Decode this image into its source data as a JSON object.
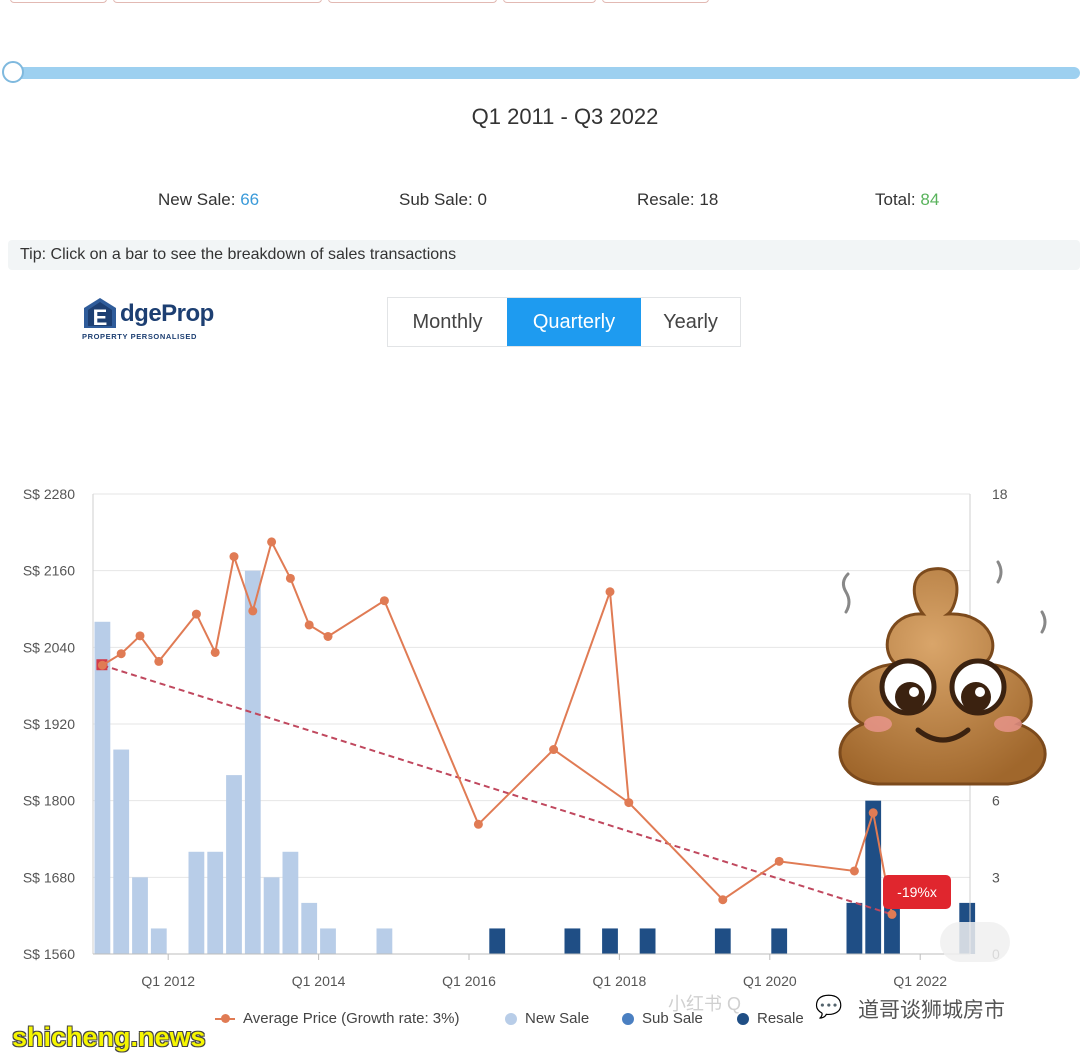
{
  "header": {
    "period_label": "Q1 2011 - Q3 2022",
    "stats": {
      "new_sale_label": "New Sale:",
      "new_sale_value": "66",
      "sub_sale_label": "Sub Sale:",
      "sub_sale_value": "0",
      "resale_label": "Resale:",
      "resale_value": "18",
      "total_label": "Total:",
      "total_value": "84"
    },
    "tip": "Tip: Click on a bar to see the breakdown of sales transactions"
  },
  "logo": {
    "word_e": "E",
    "word_rest": "dgeProp",
    "tagline": "PROPERTY PERSONALISED"
  },
  "toggle": {
    "options": [
      "Monthly",
      "Quarterly",
      "Yearly"
    ],
    "selected": "Quarterly"
  },
  "legend": {
    "average_price": "Average Price (Growth rate: 3%)",
    "new_sale": "New Sale",
    "sub_sale": "Sub Sale",
    "resale": "Resale"
  },
  "badge": {
    "text": "-19%x"
  },
  "watermark": {
    "icon": "wechat-icon",
    "text": "道哥谈狮城房市",
    "faint": "小红书 Q"
  },
  "site": {
    "text": "shicheng.news"
  },
  "colors": {
    "new_sale": "#b8cde8",
    "sub_sale": "#4a7fc1",
    "resale": "#1f4e85",
    "price": "#e07b54",
    "trend": "#c0485e",
    "accent": "#1e9bf0"
  },
  "chart_data": {
    "type": "bar",
    "x_tick_labels": [
      "Q1 2012",
      "Q1 2014",
      "Q1 2016",
      "Q1 2018",
      "Q1 2020",
      "Q1 2022"
    ],
    "x_tick_quarters": [
      "Q1 2012",
      "Q1 2014",
      "Q1 2016",
      "Q1 2018",
      "Q1 2020",
      "Q1 2022"
    ],
    "quarters_range": [
      "Q1 2011",
      "Q3 2022"
    ],
    "y_left": {
      "labels": [
        "S$ 2280",
        "S$ 2160",
        "S$ 2040",
        "S$ 1920",
        "S$ 1800",
        "S$ 1680",
        "S$ 1560"
      ],
      "min": 1560,
      "max": 2280
    },
    "y_right": {
      "labels": [
        "18",
        "6",
        "3",
        "0"
      ],
      "ticks": [
        18,
        6,
        3,
        0
      ],
      "min": 0,
      "max": 18
    },
    "series": [
      {
        "name": "New Sale",
        "bars": [
          {
            "q": "Q1 2011",
            "v": 13
          },
          {
            "q": "Q2 2011",
            "v": 8
          },
          {
            "q": "Q3 2011",
            "v": 3
          },
          {
            "q": "Q4 2011",
            "v": 1
          },
          {
            "q": "Q2 2012",
            "v": 4
          },
          {
            "q": "Q3 2012",
            "v": 4
          },
          {
            "q": "Q4 2012",
            "v": 7
          },
          {
            "q": "Q1 2013",
            "v": 15
          },
          {
            "q": "Q2 2013",
            "v": 3
          },
          {
            "q": "Q3 2013",
            "v": 4
          },
          {
            "q": "Q4 2013",
            "v": 2
          },
          {
            "q": "Q1 2014",
            "v": 1
          },
          {
            "q": "Q4 2014",
            "v": 1
          }
        ]
      },
      {
        "name": "Sub Sale",
        "bars": []
      },
      {
        "name": "Resale",
        "bars": [
          {
            "q": "Q2 2016",
            "v": 1
          },
          {
            "q": "Q2 2017",
            "v": 1
          },
          {
            "q": "Q4 2017",
            "v": 1
          },
          {
            "q": "Q2 2018",
            "v": 1
          },
          {
            "q": "Q2 2019",
            "v": 1
          },
          {
            "q": "Q1 2020",
            "v": 1
          },
          {
            "q": "Q1 2021",
            "v": 2
          },
          {
            "q": "Q2 2021",
            "v": 6
          },
          {
            "q": "Q3 2021",
            "v": 2
          },
          {
            "q": "Q3 2022",
            "v": 2
          }
        ]
      },
      {
        "name": "Average Price (Growth rate: 3%)",
        "points": [
          {
            "q": "Q1 2011",
            "v": 2012
          },
          {
            "q": "Q2 2011",
            "v": 2030
          },
          {
            "q": "Q3 2011",
            "v": 2058
          },
          {
            "q": "Q4 2011",
            "v": 2018
          },
          {
            "q": "Q2 2012",
            "v": 2092
          },
          {
            "q": "Q3 2012",
            "v": 2032
          },
          {
            "q": "Q4 2012",
            "v": 2182
          },
          {
            "q": "Q1 2013",
            "v": 2097
          },
          {
            "q": "Q2 2013",
            "v": 2205
          },
          {
            "q": "Q3 2013",
            "v": 2148
          },
          {
            "q": "Q4 2013",
            "v": 2075
          },
          {
            "q": "Q1 2014",
            "v": 2057
          },
          {
            "q": "Q4 2014",
            "v": 2113
          },
          {
            "q": "Q1 2016",
            "v": 1763
          },
          {
            "q": "Q1 2017",
            "v": 1880
          },
          {
            "q": "Q1 2018",
            "v": 1797
          },
          {
            "q": "Q2 2019",
            "v": 1645
          },
          {
            "q": "Q1 2020",
            "v": 1705
          },
          {
            "q": "Q1 2021",
            "v": 1690
          },
          {
            "q": "Q2 2021",
            "v": 1781
          },
          {
            "q": "Q3 2021",
            "v": 1622
          }
        ]
      },
      {
        "name": "Average Price",
        "points": [
          {
            "q": "Q4 2017",
            "v": 2127
          }
        ]
      }
    ],
    "trend_line": {
      "from": {
        "q": "Q1 2011",
        "v": 2012
      },
      "to": {
        "q": "Q3 2021",
        "v": 1622
      }
    },
    "grid": true,
    "legend_position": "bottom"
  }
}
